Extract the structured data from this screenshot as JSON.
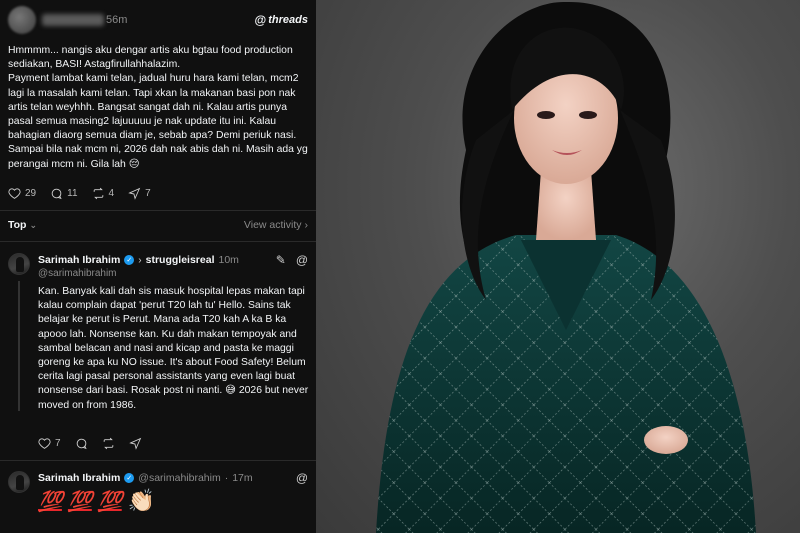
{
  "post": {
    "time": "56m",
    "brand": "threads",
    "text": "Hmmmm... nangis aku dengar artis aku bgtau food production sediakan, BASI! Astagfirullahhalazim.\nPayment lambat kami telan, jadual huru hara kami telan, mcm2 lagi la masalah kami telan. Tapi xkan la makanan basi pon nak artis telan weyhhh. Bangsat sangat dah ni.  Kalau artis punya pasal semua masing2 lajuuuuu je nak update itu ini. Kalau bahagian diaorg semua diam je, sebab apa? Demi periuk nasi. Sampai bila nak mcm ni, 2026 dah nak abis dah ni. Masih ada yg perangai mcm ni. Gila lah 😔",
    "likes": "29",
    "comments": "11",
    "reposts": "4",
    "shares": "7"
  },
  "sort": {
    "label": "Top",
    "view_activity": "View activity"
  },
  "reply1": {
    "name": "Sarimah Ibrahim",
    "target": "struggleisreal",
    "time": "10m",
    "handle": "@sarimahibrahim",
    "text": "Kan. Banyak kali dah sis masuk hospital lepas makan tapi kalau complain dapat 'perut T20 lah tu' Hello. Sains tak belajar ke perut is Perut. Mana ada T20 kah A ka B ka apooo lah. Nonsense kan. Ku dah makan tempoyak and sambal belacan and nasi and kicap and pasta ke maggi goreng ke apa ku NO issue. It's about Food Safety! Belum cerita lagi pasal personal assistants yang even lagi buat nonsense dari basi. Rosak post ni nanti. 😅 2026 but never moved on from 1986.",
    "likes": "7"
  },
  "reply2": {
    "name": "Sarimah Ibrahim",
    "handle": "@sarimahibrahim",
    "time": "17m",
    "emoji": [
      "💯",
      "💯",
      "💯",
      "👏🏻"
    ]
  },
  "icons": {
    "like": "heart-icon",
    "comment": "comment-icon",
    "repost": "repost-icon",
    "share": "share-icon"
  },
  "colors": {
    "background": "#101010",
    "text": "#f3f5f7",
    "muted": "#8a8a8a",
    "verified": "#1d9bf0",
    "dress": "#0f3b3a"
  }
}
